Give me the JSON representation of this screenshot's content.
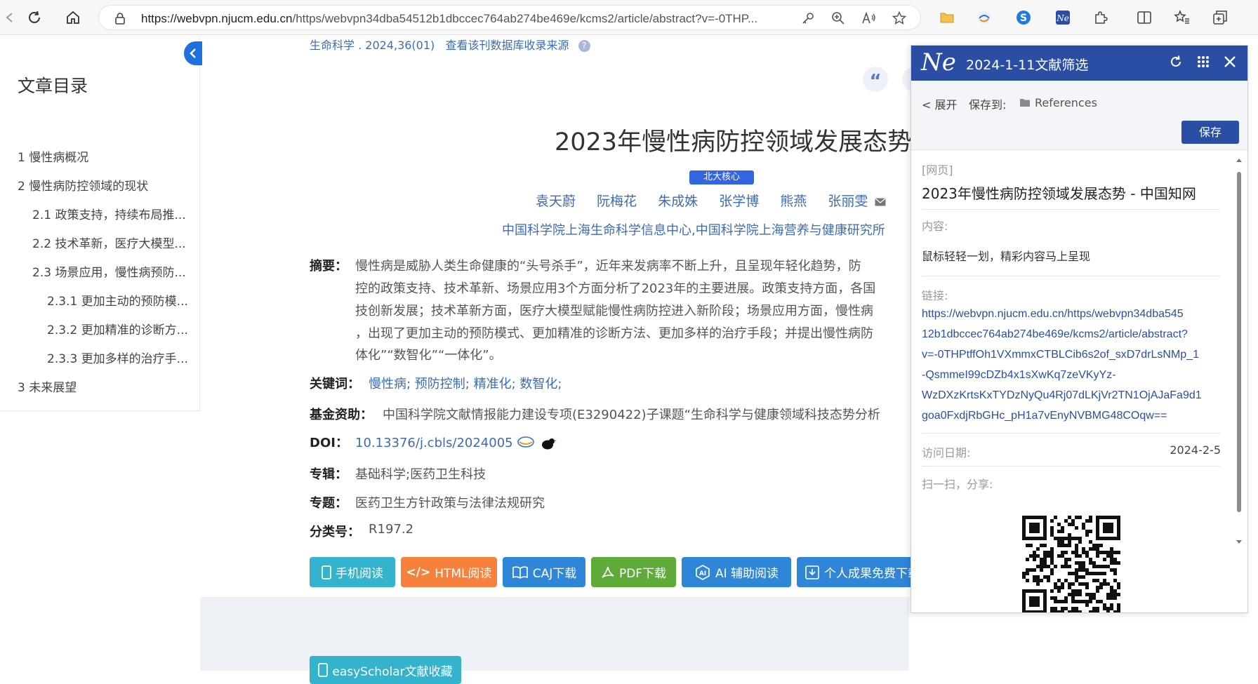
{
  "browser": {
    "url_host": "https://webvpn.njucm.edu.cn",
    "url_path": "/https/webvpn34dba54512b1dbccec764ab274be469e/kcms2/article/abstract?v=-0THP..."
  },
  "sidebar": {
    "title": "文章目录",
    "items": [
      {
        "label": "1 慢性病概况",
        "level": 1
      },
      {
        "label": "2 慢性病防控领域的现状",
        "level": 1
      },
      {
        "label": "2.1 政策支持，持续布局推...",
        "level": 2
      },
      {
        "label": "2.2 技术革新，医疗大模型...",
        "level": 2
      },
      {
        "label": "2.3 场景应用，慢性病预防...",
        "level": 2
      },
      {
        "label": "2.3.1 更加主动的预防模...",
        "level": 3
      },
      {
        "label": "2.3.2 更加精准的诊断方...",
        "level": 3
      },
      {
        "label": "2.3.3 更加多样的治疗手...",
        "level": 3
      },
      {
        "label": "3 未来展望",
        "level": 1
      }
    ]
  },
  "article": {
    "journal": "生命科学 . 2024,36(01)",
    "journal_link": "查看该刊数据库收录来源",
    "title": "2023年慢性病防控领域发展态势",
    "badge": "北大核心",
    "authors": [
      "袁天蔚",
      "阮梅花",
      "朱成姝",
      "张学博",
      "熊燕",
      "张丽雯"
    ],
    "affiliation": "中国科学院上海生命科学信息中心,中国科学院上海营养与健康研究所",
    "abstract_label": "摘要：",
    "abstract_lines": [
      "慢性病是威胁人类生命健康的“头号杀手”，近年来发病率不断上升，且呈现年轻化趋势，防",
      "控的政策支持、技术革新、场景应用3个方面分析了2023年的主要进展。政策支持方面，各国",
      "技创新发展；技术革新方面，医疗大模型赋能慢性病防控进入新阶段；场景应用方面，慢性病",
      "，出现了更加主动的预防模式、更加精准的诊断方法、更加多样的治疗手段；并提出慢性病防",
      "体化”“数智化”“一体化”。"
    ],
    "keywords_label": "关键词：",
    "keywords": "慢性病;  预防控制;  精准化;  数智化;",
    "fund_label": "基金资助：",
    "fund": "中国科学院文献情报能力建设专项(E3290422)子课题“生命科学与健康领域科技态势分析",
    "doi_label": "DOI：",
    "doi": "10.13376/j.cbls/2024005",
    "series_label": "专辑：",
    "series": "基础科学;医药卫生科技",
    "topic_label": "专题：",
    "topic": "医药卫生方针政策与法律法规研究",
    "class_label": "分类号：",
    "class_no": "R197.2"
  },
  "actions": [
    {
      "label": "手机阅读",
      "color": "#33b3cc"
    },
    {
      "label": "HTML阅读",
      "color": "#f5813c"
    },
    {
      "label": "CAJ下载",
      "color": "#2f86d6"
    },
    {
      "label": "PDF下载",
      "color": "#5fab3a"
    },
    {
      "label": "AI 辅助阅读",
      "color": "#2f86d6"
    },
    {
      "label": "个人成果免费下载",
      "color": "#2f86d6"
    },
    {
      "label": "easyScholar文献收藏",
      "color": "#33b3cc"
    }
  ],
  "panel": {
    "logo": "Ne",
    "title": "2024-1-11文献筛选",
    "expand": "< 展开",
    "save_to": "保存到:",
    "folder": "References",
    "save_button": "保存",
    "type_tag": "[网页]",
    "page_title": "2023年慢性病防控领域发展态势 - 中国知网",
    "content_label": "内容:",
    "content_text": "鼠标轻轻一划，精彩内容马上呈现",
    "link_label": "链接:",
    "link_lines": [
      "https://webvpn.njucm.edu.cn/https/webvpn34dba545",
      "12b1dbccec764ab274be469e/kcms2/article/abstract?",
      "v=-0THPtffOh1VXmmxCTBLCib6s2of_sxD7drLsNMp_1",
      "-QsmmeI99cDZb4x1sXwKq7zeVKyYz-",
      "WzDXzKrtsKxTYDzNyQu4Rj07dLKjVr2TN1OjAJaFa9d1",
      "goa0FxdjRbGHc_pH1a7vEnyNVBMG48COqw=="
    ],
    "visit_label": "访问日期:",
    "visit_date": "2024-2-5",
    "share_label": "扫一扫，分享:"
  }
}
